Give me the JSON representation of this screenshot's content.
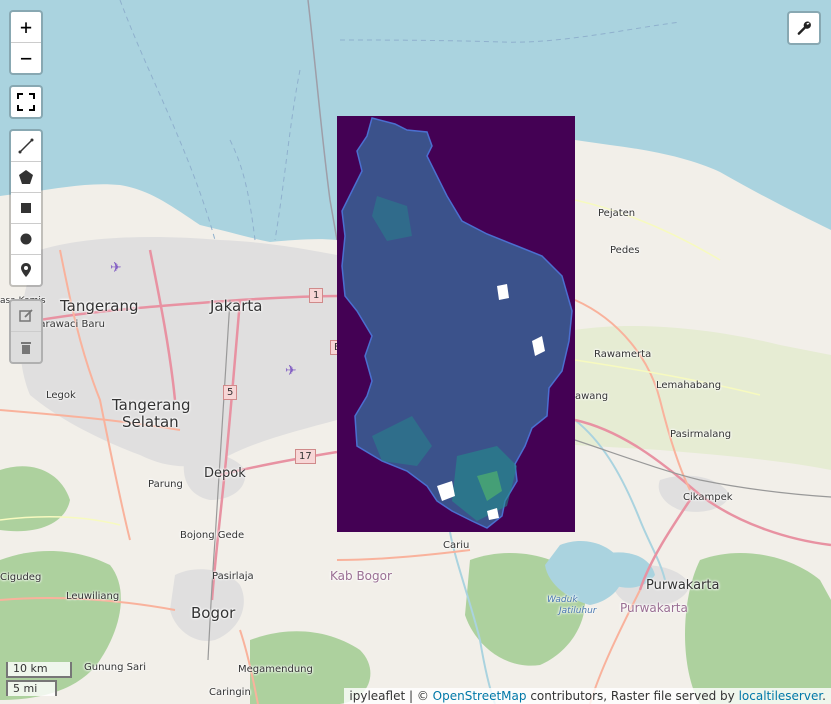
{
  "controls": {
    "zoom_in": "+",
    "zoom_out": "−",
    "fullscreen_icon": "fullscreen-icon",
    "draw_tools": [
      "polyline-icon",
      "polygon-icon",
      "rectangle-icon",
      "circle-icon",
      "marker-icon"
    ],
    "edit_tools": [
      "edit-icon",
      "delete-icon"
    ],
    "layers_icon": "wrench-icon"
  },
  "places": {
    "tangerang": "Tangerang",
    "jakarta": "Jakarta",
    "karawaci_baru": "Karawaci Baru",
    "sasa_kemis": "asa Kemis",
    "legok": "Legok",
    "tangerang_selatan_1": "Tangerang",
    "tangerang_selatan_2": "Selatan",
    "depok": "Depok",
    "parung": "Parung",
    "bojong_gede": "Bojong Gede",
    "cigudeg": "Cigudeg",
    "leuwiliang": "Leuwiliang",
    "pasirlaja": "Pasirlaja",
    "bogor": "Bogor",
    "gunung_sari": "Gunung Sari",
    "megamendung": "Megamendung",
    "caringin": "Caringin",
    "cariu": "Cariu",
    "kab_bogor": "Kab Bogor",
    "pejaten": "Pejaten",
    "pedes": "Pedes",
    "rawamerta": "Rawamerta",
    "lemahabang": "Lemahabang",
    "pasirmalang": "Pasirmalang",
    "cikampek": "Cikampek",
    "purwakarta": "Purwakarta",
    "purwakarta_region": "Purwakarta",
    "awang": "awang",
    "waduk_1": "Waduk",
    "waduk_2": "Jatiluhur"
  },
  "shields": {
    "r1": "1",
    "r5": "5",
    "r17": "17",
    "rE": "E"
  },
  "scale": {
    "km": "10 km",
    "mi": "5 mi"
  },
  "attribution": {
    "prefix": "ipyleaflet | © ",
    "osm_link": "OpenStreetMap",
    "middle": " contributors, Raster file served by ",
    "server_link": "localtileserver",
    "suffix": "."
  },
  "colors": {
    "sea": "#aad3df",
    "land": "#f2efe9",
    "urban": "#e0dfdf",
    "forest": "#add19e",
    "motorway": "#e892a2",
    "trunk": "#f9b29c",
    "raster_background": "#440154",
    "raster_low": "#3b528b",
    "raster_mid": "#21918c",
    "raster_high": "#5ec962"
  }
}
